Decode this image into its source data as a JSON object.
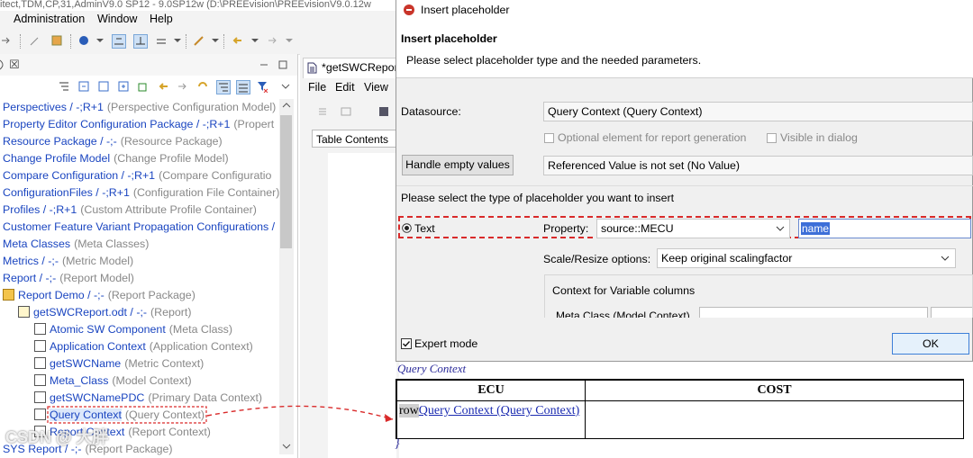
{
  "window": {
    "title": "itect,TDM,CP,31,AdminV9.0 SP12 - 9.0SP12w (D:\\PREEvision\\PREEvisionV9.0.12w"
  },
  "menu": [
    "Administration",
    "Window",
    "Help"
  ],
  "explorer": {
    "tab_close": "☒",
    "tree": [
      {
        "label": "Perspectives / -;R+1",
        "meta": "(Perspective Configuration Model)",
        "depth": 0
      },
      {
        "label": "Property Editor Configuration Package / -;R+1",
        "meta": "(Propert",
        "depth": 0
      },
      {
        "label": "Resource Package / -;-",
        "meta": "(Resource Package)",
        "depth": 0
      },
      {
        "label": "Change Profile Model",
        "meta": "(Change Profile Model)",
        "depth": 0
      },
      {
        "label": "Compare Configuration / -;R+1",
        "meta": "(Compare Configuratio",
        "depth": 0
      },
      {
        "label": "ConfigurationFiles / -;R+1",
        "meta": "(Configuration File Container)",
        "depth": 0
      },
      {
        "label": "Profiles / -;R+1",
        "meta": "(Custom Attribute Profile Container)",
        "depth": 0
      },
      {
        "label": "Customer Feature Variant Propagation Configurations /",
        "meta": "",
        "depth": 0
      },
      {
        "label": "Meta Classes",
        "meta": "(Meta Classes)",
        "depth": 0
      },
      {
        "label": "Metrics / -;-",
        "meta": "(Metric Model)",
        "depth": 0
      },
      {
        "label": "Report / -;-",
        "meta": "(Report Model)",
        "depth": 0
      },
      {
        "label": "Report Demo / -;-",
        "meta": "(Report Package)",
        "depth": 0
      },
      {
        "label": "getSWCReport.odt / -;-",
        "meta": "(Report)",
        "depth": 1
      },
      {
        "label": "Atomic SW Component",
        "meta": "(Meta Class)",
        "depth": 2
      },
      {
        "label": "Application Context",
        "meta": "(Application Context)",
        "depth": 2
      },
      {
        "label": "getSWCName",
        "meta": "(Metric Context)",
        "depth": 2
      },
      {
        "label": "Meta_Class",
        "meta": "(Model Context)",
        "depth": 2
      },
      {
        "label": "getSWCNamePDC",
        "meta": "(Primary Data Context)",
        "depth": 2
      },
      {
        "label": "Query Context",
        "meta": "(Query Context)",
        "depth": 2
      },
      {
        "label": "Report Context",
        "meta": "(Report Context)",
        "depth": 2
      },
      {
        "label": "SYS Report / -;-",
        "meta": "(Report Package)",
        "depth": 0
      }
    ]
  },
  "editor": {
    "tab_label": "*getSWCRepor",
    "menu": [
      "File",
      "Edit",
      "View"
    ],
    "toc_label": "Table Contents"
  },
  "dialog": {
    "title": "Insert placeholder",
    "header_title": "Insert placeholder",
    "header_desc": "Please select placeholder type and the needed parameters.",
    "datasource_label": "Datasource:",
    "datasource_value": "Query Context (Query Context)",
    "optional_label": "Optional element for report generation",
    "visible_label": "Visible in dialog",
    "handle_empty_label": "Handle empty values",
    "handle_empty_value": "Referenced Value is not set (No Value)",
    "select_type_label": "Please select the type of placeholder you want to insert",
    "text_radio_label": "Text",
    "property_label": "Property:",
    "property_value": "source::MECU",
    "property_attr": "name",
    "scale_label": "Scale/Resize options:",
    "scale_value": "Keep original scalingfactor",
    "context_var_label": "Context for Variable columns",
    "meta_class_label": "Meta Class (Model Context)",
    "expert_mode_label": "Expert mode",
    "ok_label": "OK"
  },
  "doc_table": {
    "header_fragment": "Query Context",
    "col1": "ECU",
    "col2": "COST",
    "row_prefix": "row",
    "row_link": "Query Context (Query Context)",
    "brace": "}"
  },
  "watermark": "CSDN @ 大胖",
  "colors": {
    "accent": "#1a45c0",
    "highlight_red": "#d92a2a",
    "selection": "#3d6fd8"
  }
}
